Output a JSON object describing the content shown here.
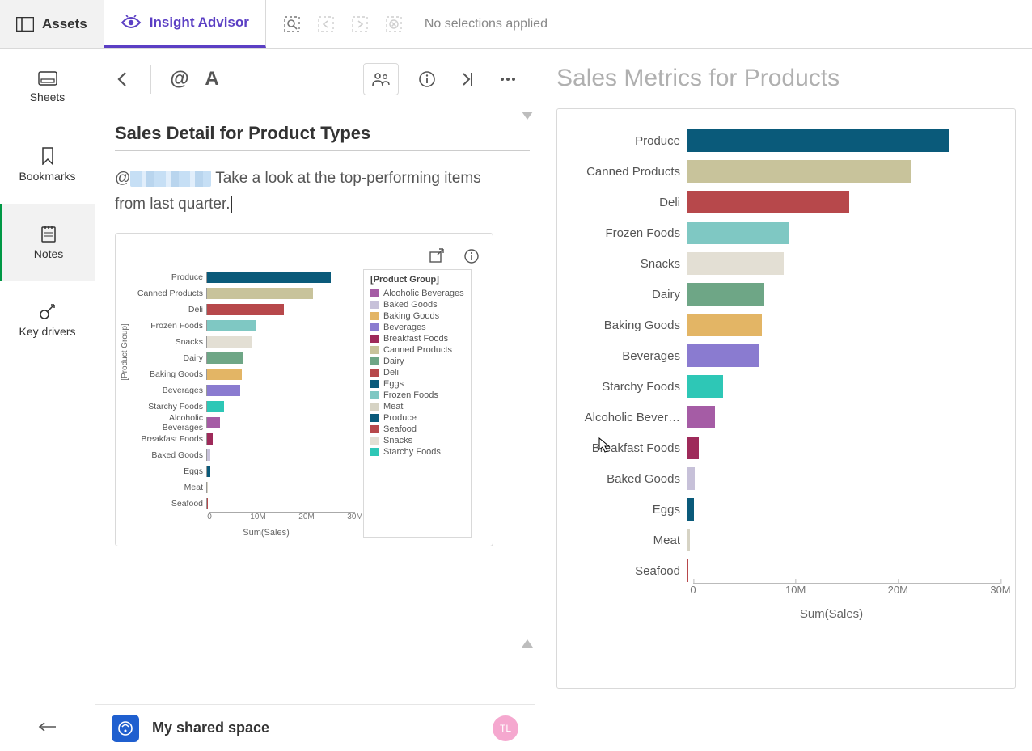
{
  "topbar": {
    "assets": "Assets",
    "insight": "Insight Advisor",
    "selections_label": "No selections applied"
  },
  "sidebar": {
    "items": [
      {
        "key": "sheets",
        "label": "Sheets"
      },
      {
        "key": "bookmarks",
        "label": "Bookmarks"
      },
      {
        "key": "notes",
        "label": "Notes"
      },
      {
        "key": "keydrivers",
        "label": "Key drivers"
      }
    ],
    "active": "notes"
  },
  "note": {
    "title": "Sales Detail for Product Types",
    "mention_prefix": "@",
    "text": "Take a look at the top-performing items from last quarter.",
    "space_label": "My shared space",
    "avatar_initials": "TL"
  },
  "legend": {
    "title": "[Product Group]",
    "items": [
      {
        "label": "Alcoholic Beverages",
        "color": "#a55ca5"
      },
      {
        "label": "Baked Goods",
        "color": "#c7c1d9"
      },
      {
        "label": "Baking Goods",
        "color": "#e3b565"
      },
      {
        "label": "Beverages",
        "color": "#8a7bd0"
      },
      {
        "label": "Breakfast Foods",
        "color": "#9e2a5a"
      },
      {
        "label": "Canned Products",
        "color": "#c8c39b"
      },
      {
        "label": "Dairy",
        "color": "#6ea686"
      },
      {
        "label": "Deli",
        "color": "#b7484b"
      },
      {
        "label": "Eggs",
        "color": "#0a5a7a"
      },
      {
        "label": "Frozen Foods",
        "color": "#7fc8c3"
      },
      {
        "label": "Meat",
        "color": "#d6d3c4"
      },
      {
        "label": "Produce",
        "color": "#0a5a7a"
      },
      {
        "label": "Seafood",
        "color": "#b7484b"
      },
      {
        "label": "Snacks",
        "color": "#e3dfd4"
      },
      {
        "label": "Starchy Foods",
        "color": "#2ec7b6"
      }
    ]
  },
  "right_title": "Sales Metrics for Products",
  "chart_data": {
    "type": "bar",
    "orientation": "horizontal",
    "xlabel": "Sum(Sales)",
    "ylabel": "[Product Group]",
    "xlim": [
      0,
      30000000
    ],
    "ticks": [
      0,
      10000000,
      20000000,
      30000000
    ],
    "tick_labels": [
      "0",
      "10M",
      "20M",
      "30M"
    ],
    "series": [
      {
        "name": "Produce",
        "value": 25000000,
        "color": "#0a5a7a"
      },
      {
        "name": "Canned Products",
        "value": 21500000,
        "color": "#c8c39b"
      },
      {
        "name": "Deli",
        "value": 15500000,
        "color": "#b7484b"
      },
      {
        "name": "Frozen Foods",
        "value": 9800000,
        "color": "#7fc8c3"
      },
      {
        "name": "Snacks",
        "value": 9200000,
        "color": "#e3dfd4"
      },
      {
        "name": "Dairy",
        "value": 7400000,
        "color": "#6ea686"
      },
      {
        "name": "Baking Goods",
        "value": 7100000,
        "color": "#e3b565"
      },
      {
        "name": "Beverages",
        "value": 6800000,
        "color": "#8a7bd0"
      },
      {
        "name": "Starchy Foods",
        "value": 3400000,
        "color": "#2ec7b6"
      },
      {
        "name": "Alcoholic Bever…",
        "value": 2600000,
        "color": "#a55ca5"
      },
      {
        "name": "Breakfast Foods",
        "value": 1100000,
        "color": "#9e2a5a"
      },
      {
        "name": "Baked Goods",
        "value": 700000,
        "color": "#c7c1d9"
      },
      {
        "name": "Eggs",
        "value": 600000,
        "color": "#0a5a7a"
      },
      {
        "name": "Meat",
        "value": 200000,
        "color": "#d6d3c4"
      },
      {
        "name": "Seafood",
        "value": 100000,
        "color": "#b7484b"
      }
    ]
  },
  "mini_chart_data": {
    "type": "bar",
    "orientation": "horizontal",
    "xlabel": "Sum(Sales)",
    "ylabel": "[Product Group]",
    "xlim": [
      0,
      30000000
    ],
    "ticks": [
      0,
      10000000,
      20000000,
      30000000
    ],
    "tick_labels": [
      "0",
      "10M",
      "20M",
      "30M"
    ],
    "series": [
      {
        "name": "Produce",
        "value": 25000000,
        "color": "#0a5a7a"
      },
      {
        "name": "Canned Products",
        "value": 21500000,
        "color": "#c8c39b"
      },
      {
        "name": "Deli",
        "value": 15500000,
        "color": "#b7484b"
      },
      {
        "name": "Frozen Foods",
        "value": 9800000,
        "color": "#7fc8c3"
      },
      {
        "name": "Snacks",
        "value": 9200000,
        "color": "#e3dfd4"
      },
      {
        "name": "Dairy",
        "value": 7400000,
        "color": "#6ea686"
      },
      {
        "name": "Baking Goods",
        "value": 7100000,
        "color": "#e3b565"
      },
      {
        "name": "Beverages",
        "value": 6800000,
        "color": "#8a7bd0"
      },
      {
        "name": "Starchy Foods",
        "value": 3400000,
        "color": "#2ec7b6"
      },
      {
        "name": "Alcoholic Beverages",
        "value": 2600000,
        "color": "#a55ca5"
      },
      {
        "name": "Breakfast Foods",
        "value": 1100000,
        "color": "#9e2a5a"
      },
      {
        "name": "Baked Goods",
        "value": 700000,
        "color": "#c7c1d9"
      },
      {
        "name": "Eggs",
        "value": 600000,
        "color": "#0a5a7a"
      },
      {
        "name": "Meat",
        "value": 200000,
        "color": "#d6d3c4"
      },
      {
        "name": "Seafood",
        "value": 100000,
        "color": "#b7484b"
      }
    ]
  }
}
